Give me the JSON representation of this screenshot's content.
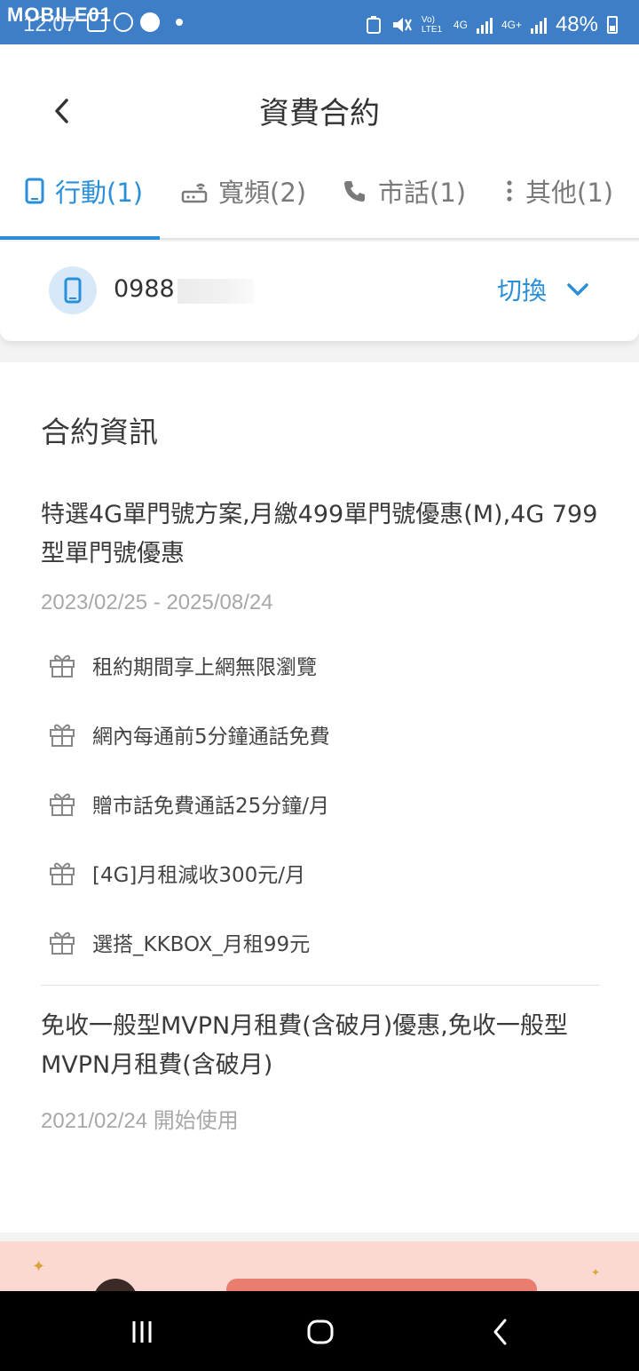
{
  "status_bar": {
    "watermark": "MOBILE01",
    "time": "12:07",
    "network_label_1": "Vo) LTE1",
    "network_label_2": "4G",
    "network_label_3": "4G+",
    "battery": "48%"
  },
  "header": {
    "title": "資費合約"
  },
  "tabs": [
    {
      "label": "行動(1)",
      "icon": "mobile-phone-icon",
      "active": true
    },
    {
      "label": "寬頻(2)",
      "icon": "router-icon",
      "active": false
    },
    {
      "label": "市話(1)",
      "icon": "telephone-icon",
      "active": false
    },
    {
      "label": "其他(1)",
      "icon": "more-vertical-icon",
      "active": false
    }
  ],
  "number_selector": {
    "number_prefix": "0988",
    "switch_label": "切換"
  },
  "contract_section": {
    "title": "合約資訊",
    "contracts": [
      {
        "name": "特選4G單門號方案,月繳499單門號優惠(M),4G 799型單門號優惠",
        "period": "2023/02/25 - 2025/08/24",
        "benefits": [
          "租約期間享上網無限瀏覽",
          "網內每通前5分鐘通話免費",
          "贈市話免費通話25分鐘/月",
          "[4G]月租減收300元/月",
          "選搭_KKBOX_月租99元"
        ]
      },
      {
        "name": "免收一般型MVPN月租費(含破月)優惠,免收一般型MVPN月租費(含破月)",
        "period": "2021/02/24 開始使用"
      }
    ]
  },
  "colors": {
    "accent": "#2a8fd8",
    "status_bar": "#3d7ec6",
    "text_primary": "#3a3a3a",
    "text_muted": "#a8a8a8"
  }
}
